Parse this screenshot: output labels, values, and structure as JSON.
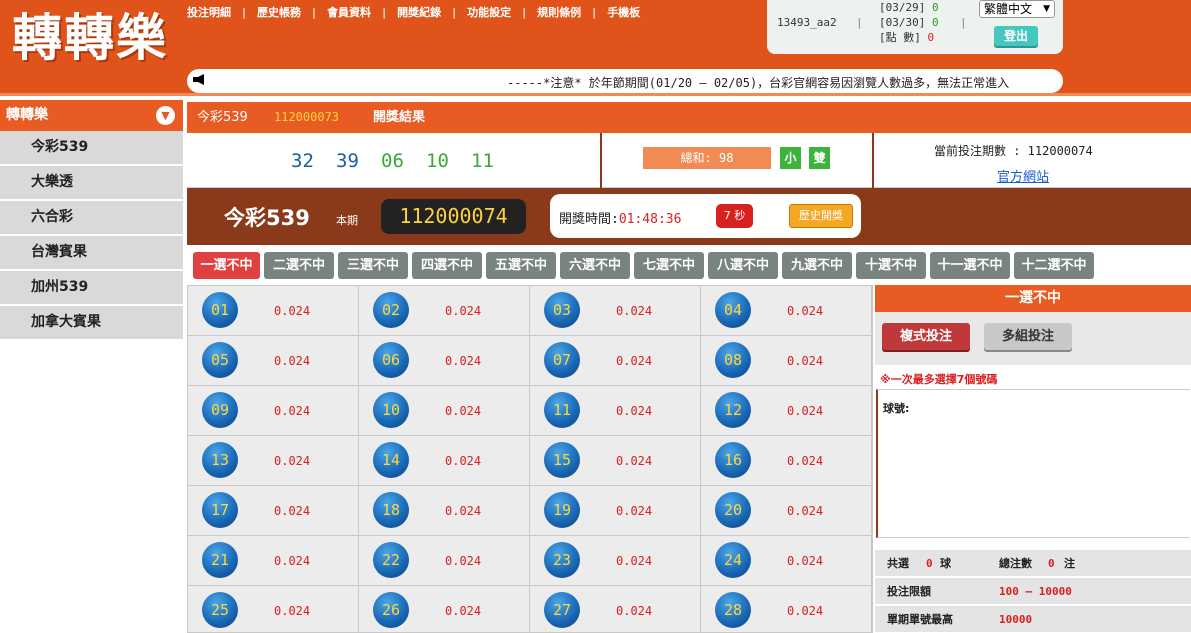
{
  "logo": "轉轉樂",
  "topnav": [
    "投注明細",
    "歷史帳務",
    "會員資料",
    "開獎紀錄",
    "功能設定",
    "規則條例",
    "手機板"
  ],
  "user": {
    "username": "13493_aa2",
    "stats": [
      {
        "label": "[03/29]",
        "value": "0"
      },
      {
        "label": "[03/30]",
        "value": "0"
      },
      {
        "label": "[點 數]",
        "value": "0"
      }
    ],
    "language": "繁體中文",
    "logout_label": "登出"
  },
  "marquee": "-----*注意* 於年節期間(01/20 – 02/05)，台彩官網容易因瀏覽人數過多，無法正常進入",
  "sidebar": {
    "header": "轉轉樂",
    "items": [
      "今彩539",
      "大樂透",
      "六合彩",
      "台灣賓果",
      "加州539",
      "加拿大賓果"
    ]
  },
  "mainbar": {
    "game": "今彩539",
    "period": "112000073",
    "result_label": "開獎結果"
  },
  "result": {
    "numbers": [
      "32",
      "39",
      "06",
      "10",
      "11"
    ],
    "number_colors": [
      "#1a5fa0",
      "#1a5fa0",
      "#3aa83a",
      "#3aa83a",
      "#3aa83a"
    ],
    "sum_label": "總和: 98",
    "badge_small": "小",
    "badge_even": "雙",
    "current_period": "當前投注期數 : 112000074",
    "official_site": "官方網站"
  },
  "gamebar": {
    "title": "今彩539",
    "period_label": "本期",
    "period": "112000074",
    "draw_time_label": "開獎時間:",
    "draw_time": "01:48:36",
    "seconds_label": "7 秒",
    "history_label": "歷史開獎"
  },
  "tabs": [
    "一選不中",
    "二選不中",
    "三選不中",
    "四選不中",
    "五選不中",
    "六選不中",
    "七選不中",
    "八選不中",
    "九選不中",
    "十選不中",
    "十一選不中",
    "十二選不中"
  ],
  "active_tab": 0,
  "grid": {
    "numbers": [
      "01",
      "02",
      "03",
      "04",
      "05",
      "06",
      "07",
      "08",
      "09",
      "10",
      "11",
      "12",
      "13",
      "14",
      "15",
      "16",
      "17",
      "18",
      "19",
      "20",
      "21",
      "22",
      "23",
      "24",
      "25",
      "26",
      "27",
      "28"
    ],
    "odds": "0.024"
  },
  "panel": {
    "title": "一選不中",
    "btn_compound": "複式投注",
    "btn_multi": "多組投注",
    "note": "※一次最多選擇7個號碼",
    "ball_label": "球號:",
    "total_label": "共選",
    "total_value": "0",
    "total_unit": "球",
    "bets_label": "總注數",
    "bets_value": "0",
    "bets_unit": "注",
    "limit_label": "投注限額",
    "limit_value": "100 – 10000",
    "max_label": "單期單號最高",
    "max_value": "10000"
  },
  "colors": {
    "header": "#e0541c",
    "accent": "#e85c24",
    "dark_brown": "#8a3a1a",
    "odds": "#d82020",
    "ball": "#1a6ab8",
    "active_tab": "#e04040",
    "tab": "#7a847e"
  },
  "icons": {
    "marquee": "megaphone-icon",
    "sidebar_toggle": "chevron-down-icon",
    "lang_select": "caret-down-icon"
  }
}
